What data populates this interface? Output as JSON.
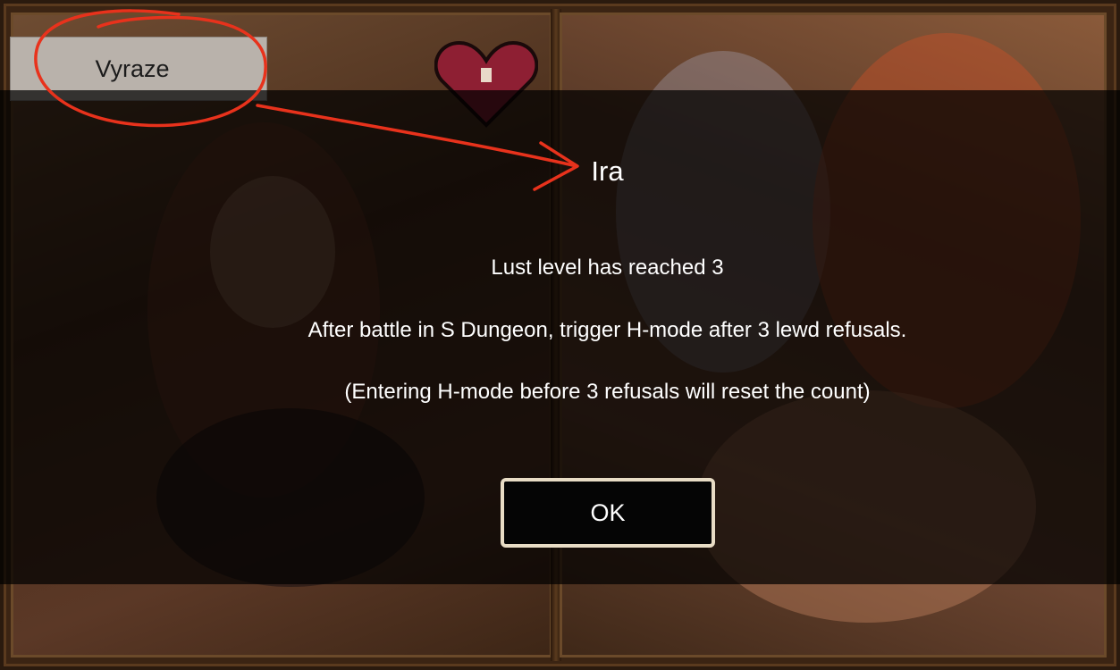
{
  "name_tab": {
    "label": "Vyraze"
  },
  "dialog": {
    "title": "Ira",
    "lines": [
      "Lust level has reached 3",
      "After battle in S Dungeon, trigger H-mode after 3 lewd refusals.",
      "(Entering H-mode before 3 refusals will reset the count)"
    ],
    "ok_label": "OK"
  },
  "colors": {
    "annotation": "#e8321c",
    "button_border": "#e8dcc5",
    "heart": "#8e1f33"
  }
}
